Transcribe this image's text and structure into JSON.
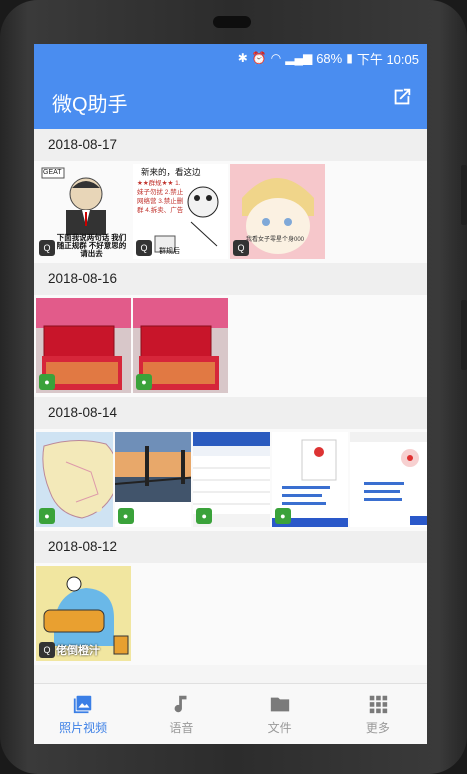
{
  "status_bar": {
    "battery": "68%",
    "time": "下午 10:05"
  },
  "app_bar": {
    "title": "微Q助手"
  },
  "groups": [
    {
      "date": "2018-08-17",
      "items": [
        "meme-suit",
        "meme-panda-rules",
        "meme-blonde"
      ]
    },
    {
      "date": "2018-08-16",
      "items": [
        "red-boxes-1",
        "red-boxes-2"
      ]
    },
    {
      "date": "2018-08-14",
      "items": [
        "map",
        "bridge",
        "screenshot-form",
        "screenshot-chat",
        "screenshot-list"
      ]
    },
    {
      "date": "2018-08-12",
      "items": [
        "cartoon-fish"
      ]
    }
  ],
  "thumb_captions": {
    "meme_suit_top": "GEAT",
    "meme_suit_bottom": "下面我说两句话 我们随正规群 不好意思的请出去",
    "meme_panda_title": "新来的，看这边",
    "meme_panda_rules": "★★群规★★ 1.妹子勿扰 2.禁止网络营 3.禁止删群 4.拆卖、广告",
    "meme_panda_foot": "群规后",
    "meme_blonde_text": "我看女子零星个身000",
    "cartoon_fish_caption": "佬倒橙汁"
  },
  "bottom_nav": [
    {
      "label": "照片视频",
      "icon": "photo-icon",
      "active": true
    },
    {
      "label": "语音",
      "icon": "music-note-icon",
      "active": false
    },
    {
      "label": "文件",
      "icon": "folder-icon",
      "active": false
    },
    {
      "label": "更多",
      "icon": "grid-icon",
      "active": false
    }
  ],
  "colors": {
    "primary": "#4a8df0",
    "nav_active": "#3b7fe6",
    "nav_inactive": "#9a9a9a"
  }
}
